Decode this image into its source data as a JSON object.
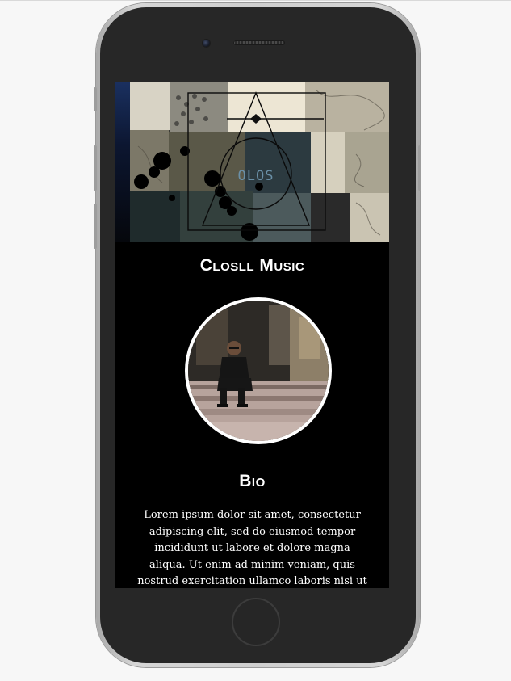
{
  "site": {
    "banner_logo_text": "OLOS",
    "title": "Closll Music"
  },
  "profile": {
    "photo_alt": "artist photo"
  },
  "bio": {
    "heading": "Bio",
    "text": "Lorem ipsum dolor sit amet, consectetur adipiscing elit, sed do eiusmod tempor incididunt ut labore et dolore magna aliqua. Ut enim ad minim veniam, quis nostrud exercitation ullamco laboris nisi ut aliquip ex"
  },
  "colors": {
    "page_background": "#f7f7f7",
    "phone_body": "#272727",
    "screen_background": "#000000",
    "text": "#ffffff",
    "profile_ring": "#ffffff"
  },
  "icons": [
    "camera-icon",
    "speaker-grille-icon",
    "home-button-icon"
  ]
}
